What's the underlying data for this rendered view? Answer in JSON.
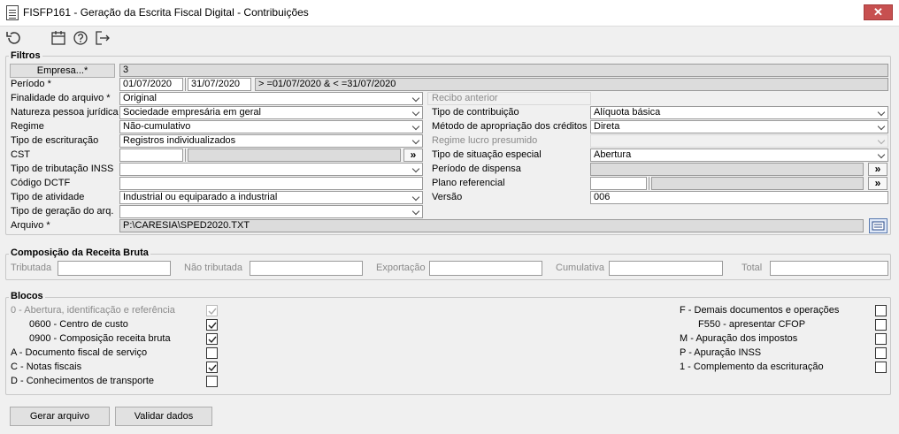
{
  "window": {
    "title": "FISFP161 - Geração da Escrita Fiscal Digital - Contribuições",
    "close_label": "✕"
  },
  "toolbar": {
    "icons": [
      "undo-icon",
      "calendar-icon",
      "help-icon",
      "exit-icon"
    ]
  },
  "filtros": {
    "legend": "Filtros",
    "empresa_button": "Empresa...*",
    "empresa_value": "3",
    "periodo_label": "Período *",
    "periodo_inicio": "01/07/2020",
    "periodo_fim": "31/07/2020",
    "periodo_expr": "> =01/07/2020 & < =31/07/2020",
    "finalidade_label": "Finalidade do arquivo *",
    "finalidade_value": "Original",
    "recibo_label": "Recibo anterior",
    "natureza_label": "Natureza pessoa jurídica",
    "natureza_value": "Sociedade empresária em geral",
    "tipo_contrib_label": "Tipo de contribuição",
    "tipo_contrib_value": "Alíquota básica",
    "regime_label": "Regime",
    "regime_value": "Não-cumulativo",
    "metodo_label": "Método de apropriação dos créditos",
    "metodo_value": "Direta",
    "tipo_escrit_label": "Tipo de escrituração",
    "tipo_escrit_value": "Registros individualizados",
    "regime_lucro_label": "Regime lucro presumido",
    "cst_label": "CST",
    "cst_button": "»",
    "tipo_situacao_label": "Tipo de situação especial",
    "tipo_situacao_value": "Abertura",
    "tipo_trib_inss_label": "Tipo de tributação INSS",
    "periodo_dispensa_label": "Período de dispensa",
    "periodo_dispensa_button": "»",
    "codigo_dctf_label": "Código DCTF",
    "plano_ref_label": "Plano referencial",
    "plano_ref_button": "»",
    "tipo_atividade_label": "Tipo de atividade",
    "tipo_atividade_value": "Industrial ou equiparado a industrial",
    "versao_label": "Versão",
    "versao_value": "006",
    "tipo_geracao_label": "Tipo de geração do arq.",
    "arquivo_label": "Arquivo *",
    "arquivo_value": "P:\\CARESIA\\SPED2020.TXT"
  },
  "composicao": {
    "legend": "Composição da Receita Bruta",
    "tributada": "Tributada",
    "nao_tributada": "Não tributada",
    "exportacao": "Exportação",
    "cumulativa": "Cumulativa",
    "total": "Total"
  },
  "blocos": {
    "legend": "Blocos",
    "left": [
      {
        "label": "0 - Abertura, identificação e referência",
        "checked": true,
        "disabled": true
      },
      {
        "label": "0600 - Centro de custo",
        "checked": true,
        "disabled": false
      },
      {
        "label": "0900 - Composição receita bruta",
        "checked": true,
        "disabled": false
      },
      {
        "label": "A - Documento fiscal de serviço",
        "checked": false,
        "disabled": false
      },
      {
        "label": "C - Notas fiscais",
        "checked": true,
        "disabled": false
      },
      {
        "label": "D - Conhecimentos de transporte",
        "checked": false,
        "disabled": false
      }
    ],
    "right": [
      {
        "label": "F - Demais documentos e operações",
        "checked": false
      },
      {
        "label": "F550 - apresentar CFOP",
        "checked": false
      },
      {
        "label": "M - Apuração dos impostos",
        "checked": false
      },
      {
        "label": "P - Apuração INSS",
        "checked": false
      },
      {
        "label": "1 - Complemento da escrituração",
        "checked": false
      }
    ]
  },
  "actions": {
    "gerar": "Gerar arquivo",
    "validar": "Validar dados"
  }
}
